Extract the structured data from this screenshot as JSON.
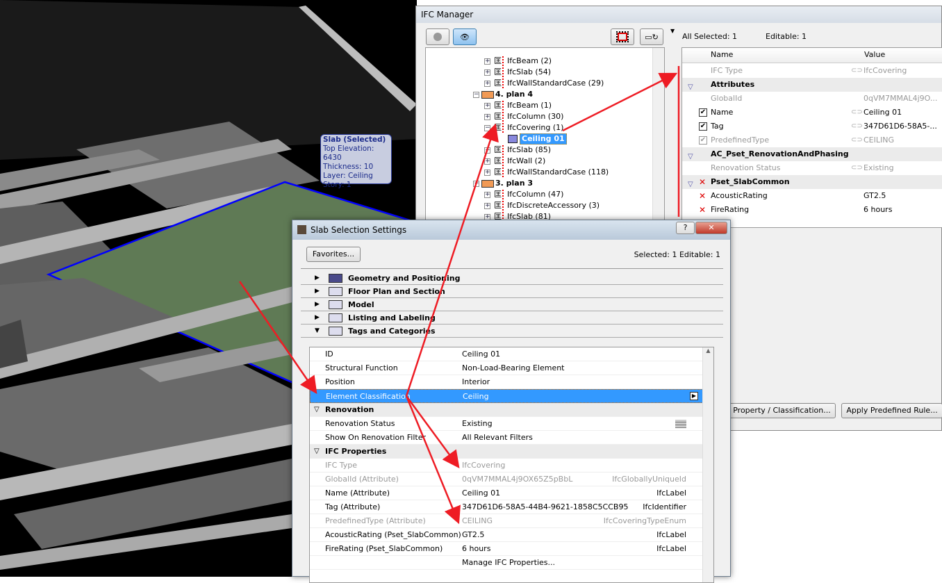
{
  "tooltip": {
    "title": "Slab (Selected)",
    "lines": [
      "Top Elevation: 6430",
      "Thickness: 10",
      "Layer: Ceiling",
      "Story: 1"
    ]
  },
  "ifc_manager": {
    "title": "IFC Manager",
    "tree": [
      {
        "level": 2,
        "label": "IfcBeam (2)",
        "exp": "+"
      },
      {
        "level": 2,
        "label": "IfcSlab (54)",
        "exp": "+"
      },
      {
        "level": 2,
        "label": "IfcWallStandardCase (29)",
        "exp": "+"
      },
      {
        "level": 1,
        "label": "4. plan 4",
        "exp": "−"
      },
      {
        "level": 2,
        "label": "IfcBeam (1)",
        "exp": "+"
      },
      {
        "level": 2,
        "label": "IfcColumn (30)",
        "exp": "+"
      },
      {
        "level": 2,
        "label": "IfcCovering (1)",
        "exp": "−"
      },
      {
        "level": 3,
        "label": "Ceiling 01",
        "selected": true
      },
      {
        "level": 2,
        "label": "IfcSlab (85)",
        "exp": "+"
      },
      {
        "level": 2,
        "label": "IfcWall (2)",
        "exp": "+"
      },
      {
        "level": 2,
        "label": "IfcWallStandardCase (118)",
        "exp": "+"
      },
      {
        "level": 1,
        "label": "3. plan 3",
        "exp": "−"
      },
      {
        "level": 2,
        "label": "IfcColumn (47)",
        "exp": "+"
      },
      {
        "level": 2,
        "label": "IfcDiscreteAccessory (3)",
        "exp": "+"
      },
      {
        "level": 2,
        "label": "IfcSlab (81)",
        "exp": "+"
      }
    ],
    "all_selected": "All Selected: 1",
    "editable": "Editable: 1",
    "columns": {
      "name": "Name",
      "value": "Value"
    },
    "properties": [
      {
        "type": "row",
        "name": "IFC Type",
        "value": "IfcCovering",
        "gray": true,
        "link": true
      },
      {
        "type": "group",
        "name": "Attributes"
      },
      {
        "type": "row",
        "name": "GlobalId",
        "value": "0qVM7MMAL4j9O...",
        "gray": true
      },
      {
        "type": "row",
        "name": "Name",
        "value": "Ceiling 01",
        "check": "on",
        "link": true
      },
      {
        "type": "row",
        "name": "Tag",
        "value": "347D61D6-58A5-...",
        "check": "on",
        "link": true
      },
      {
        "type": "row",
        "name": "PredefinedType",
        "value": "CEILING",
        "check": "gray",
        "gray": true,
        "link": true
      },
      {
        "type": "group",
        "name": "AC_Pset_RenovationAndPhasing"
      },
      {
        "type": "row",
        "name": "Renovation Status",
        "value": "Existing",
        "gray": true,
        "link": true
      },
      {
        "type": "group",
        "name": "Pset_SlabCommon",
        "x": true
      },
      {
        "type": "row",
        "name": "AcousticRating",
        "value": "GT2.5",
        "x": true
      },
      {
        "type": "row",
        "name": "FireRating",
        "value": "6 hours",
        "x": true
      }
    ],
    "buttons": {
      "property_classification": "Property / Classification...",
      "apply_rule": "Apply Predefined Rule..."
    }
  },
  "slab_dialog": {
    "title": "Slab Selection Settings",
    "favorites": "Favorites...",
    "selected_info": "Selected: 1 Editable: 1",
    "sections": [
      {
        "label": "Geometry and Positioning",
        "expanded": false,
        "icon": "geometry-icon"
      },
      {
        "label": "Floor Plan and Section",
        "expanded": false,
        "icon": "floor-plan-icon"
      },
      {
        "label": "Model",
        "expanded": false,
        "icon": "model-icon"
      },
      {
        "label": "Listing and Labeling",
        "expanded": false,
        "icon": "listing-icon"
      },
      {
        "label": "Tags and Categories",
        "expanded": true,
        "icon": "tags-icon"
      }
    ],
    "rows": [
      {
        "name": "ID",
        "value": "Ceiling 01"
      },
      {
        "name": "Structural Function",
        "value": "Non-Load-Bearing Element"
      },
      {
        "name": "Position",
        "value": "Interior"
      },
      {
        "name": "Element Classification",
        "value": "Ceiling",
        "highlight": true
      },
      {
        "group": "Renovation"
      },
      {
        "name": "Renovation Status",
        "value": "Existing",
        "icon": "brick-icon"
      },
      {
        "name": "Show On Renovation Filter",
        "value": "All Relevant Filters"
      },
      {
        "group": "IFC Properties"
      },
      {
        "name": "IFC Type",
        "value": "IfcCovering",
        "gray": true
      },
      {
        "name": "GlobalId (Attribute)",
        "value": "0qVM7MMAL4j9OX65Z5pBbL",
        "type": "IfcGloballyUniqueId",
        "gray": true
      },
      {
        "name": "Name (Attribute)",
        "value": "Ceiling 01",
        "type": "IfcLabel"
      },
      {
        "name": "Tag (Attribute)",
        "value": "347D61D6-58A5-44B4-9621-1858C5CCB95",
        "type": "IfcIdentifier"
      },
      {
        "name": "PredefinedType (Attribute)",
        "value": "CEILING",
        "type": "IfcCoveringTypeEnum",
        "gray": true
      },
      {
        "name": "AcousticRating (Pset_SlabCommon)",
        "value": "GT2.5",
        "type": "IfcLabel"
      },
      {
        "name": "FireRating (Pset_SlabCommon)",
        "value": "6 hours",
        "type": "IfcLabel"
      },
      {
        "name": "",
        "value": "Manage IFC Properties...",
        "link": true
      }
    ]
  },
  "colors": {
    "arrow": "#ee1c24",
    "selection": "#3399ff",
    "slab_outline": "#0000ff",
    "slab_fill": "#5f7a55"
  }
}
